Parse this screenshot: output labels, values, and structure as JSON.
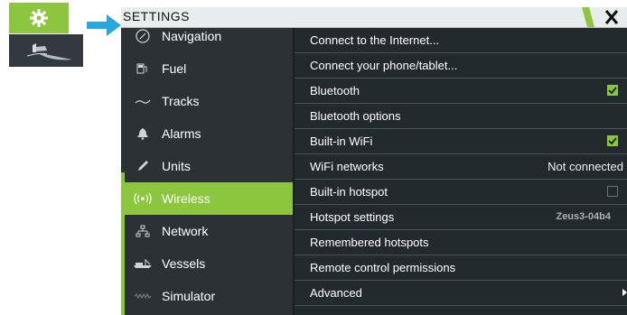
{
  "window": {
    "title": "SETTINGS"
  },
  "sidebar": {
    "items": [
      {
        "label": "Navigation",
        "icon": "compass-icon",
        "selected": false
      },
      {
        "label": "Fuel",
        "icon": "fuel-pump-icon",
        "selected": false
      },
      {
        "label": "Tracks",
        "icon": "track-icon",
        "selected": false
      },
      {
        "label": "Alarms",
        "icon": "bell-icon",
        "selected": false
      },
      {
        "label": "Units",
        "icon": "pencil-icon",
        "selected": false
      },
      {
        "label": "Wireless",
        "icon": "wireless-icon",
        "selected": true
      },
      {
        "label": "Network",
        "icon": "network-icon",
        "selected": false
      },
      {
        "label": "Vessels",
        "icon": "vessel-icon",
        "selected": false
      },
      {
        "label": "Simulator",
        "icon": "simulator-icon",
        "selected": false
      }
    ]
  },
  "options": [
    {
      "label": "Connect to the Internet...",
      "value": ""
    },
    {
      "label": "Connect your phone/tablet...",
      "value": ""
    },
    {
      "label": "Bluetooth",
      "value": "",
      "checked": true
    },
    {
      "label": "Bluetooth options",
      "value": ""
    },
    {
      "label": "Built-in WiFi",
      "value": "",
      "checked": true
    },
    {
      "label": "WiFi networks",
      "value": "Not connected"
    },
    {
      "label": "Built-in hotspot",
      "value": "",
      "checked": false
    },
    {
      "label": "Hotspot settings",
      "value": "Zeus3-04b4"
    },
    {
      "label": "Remembered hotspots",
      "value": ""
    },
    {
      "label": "Remote control permissions",
      "value": ""
    },
    {
      "label": "Advanced",
      "value": ""
    }
  ],
  "colors": {
    "accent": "#8cc63f",
    "panel": "#232a2e",
    "sidebar": "#2b3135",
    "titlebar": "#e9eced"
  }
}
